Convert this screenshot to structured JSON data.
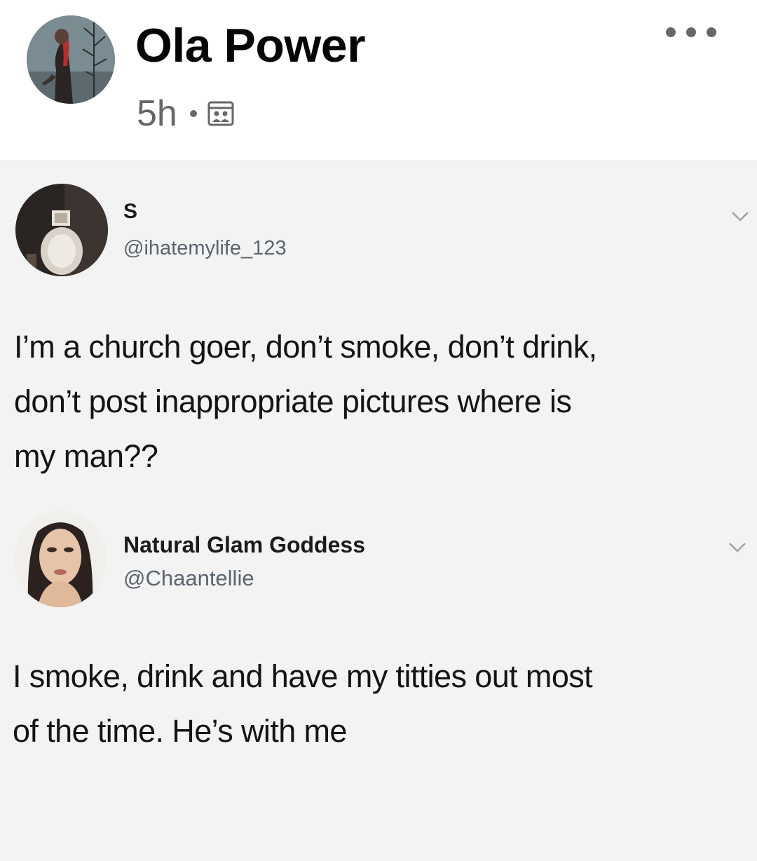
{
  "post": {
    "author_name": "Ola Power",
    "time": "5h",
    "audience_icon": "photo-audience-icon",
    "more_icon": "more-options-icon"
  },
  "tweets": [
    {
      "name": "S",
      "handle": "@ihatemylife_123",
      "text_lines": [
        "I’m a church goer, don’t smoke, don’t drink,",
        "don’t post inappropriate pictures where is",
        "my man??"
      ]
    },
    {
      "name": "Natural Glam Goddess",
      "handle": "@Chaantellie",
      "text_lines": [
        "I smoke, drink and have my titties out most",
        "of the time. He’s with me"
      ]
    }
  ],
  "colors": {
    "background": "#ffffff",
    "image_background": "#f3f3f3",
    "primary_text": "#050505",
    "secondary_text": "#65676b",
    "handle_text": "#5b6570"
  }
}
